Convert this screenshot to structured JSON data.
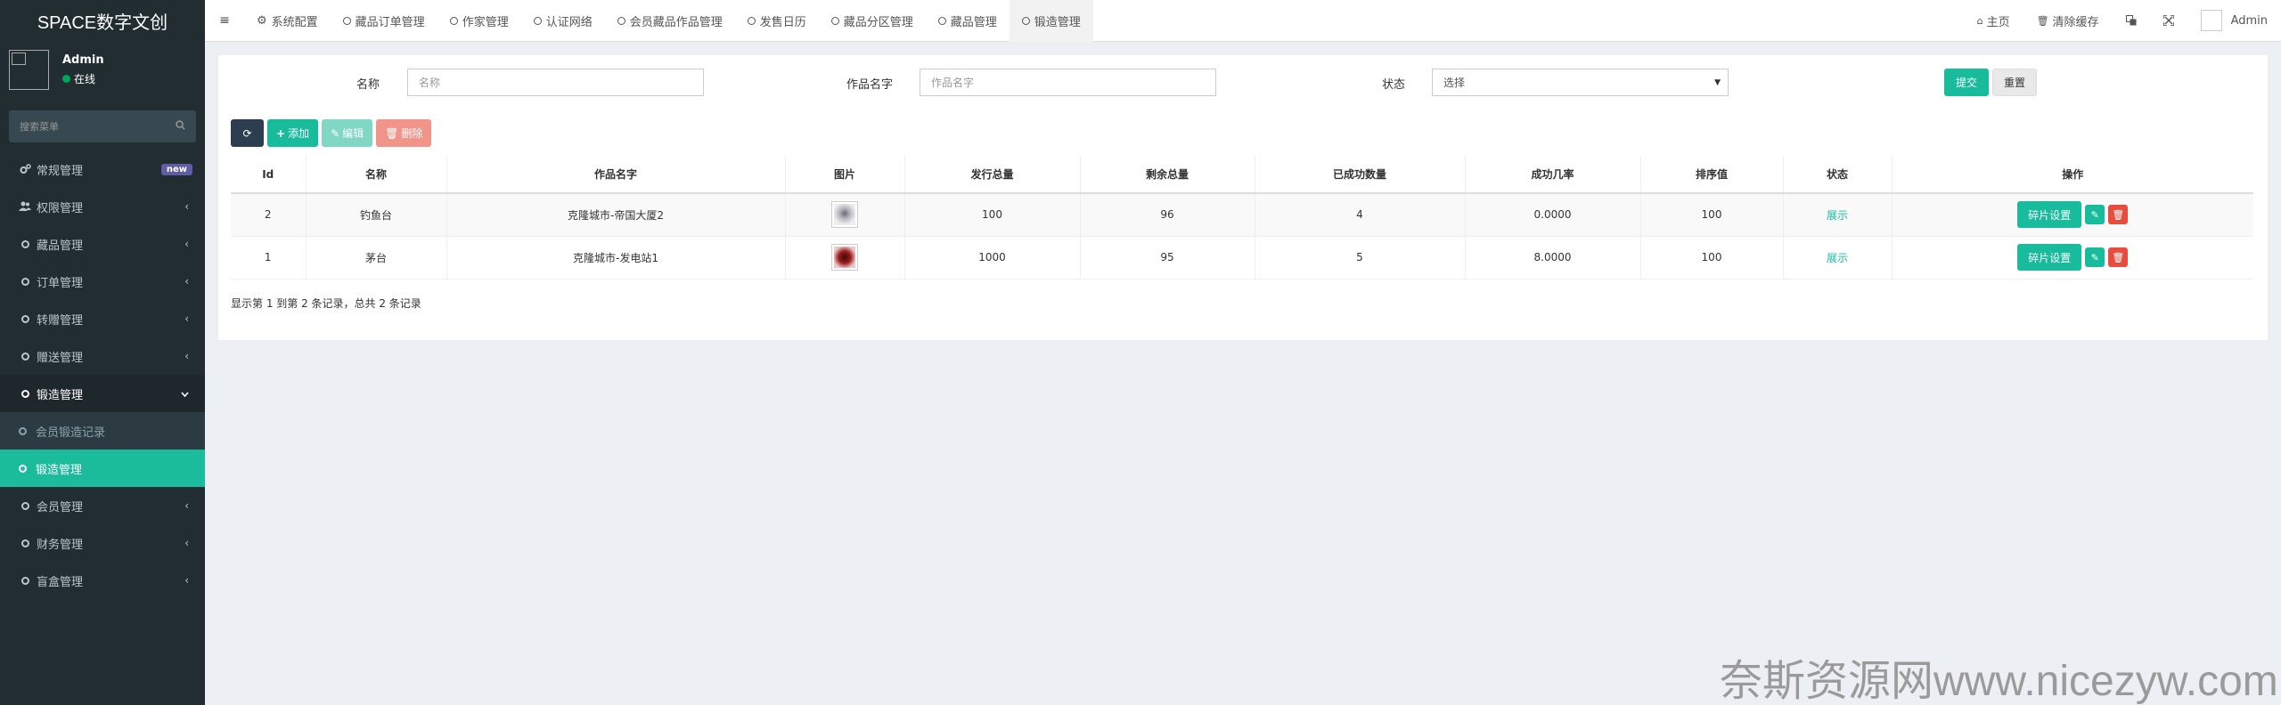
{
  "app": {
    "title": "SPACE数字文创"
  },
  "user": {
    "name": "Admin",
    "status": "在线"
  },
  "sidebar": {
    "search_placeholder": "搜索菜单",
    "items": [
      {
        "label": "常规管理",
        "badge": "new"
      },
      {
        "label": "权限管理"
      },
      {
        "label": "藏品管理"
      },
      {
        "label": "订单管理"
      },
      {
        "label": "转赠管理"
      },
      {
        "label": "赠送管理"
      },
      {
        "label": "锻造管理"
      },
      {
        "label": "会员锻造记录"
      },
      {
        "label": "锻造管理"
      },
      {
        "label": "会员管理"
      },
      {
        "label": "财务管理"
      },
      {
        "label": "盲盒管理"
      }
    ]
  },
  "topbar": {
    "tabs": [
      "系统配置",
      "藏品订单管理",
      "作家管理",
      "认证网络",
      "会员藏品作品管理",
      "发售日历",
      "藏品分区管理",
      "藏品管理",
      "锻造管理"
    ],
    "home": "主页",
    "clear_cache": "清除缓存",
    "user": "Admin"
  },
  "filters": {
    "name_label": "名称",
    "name_placeholder": "名称",
    "work_label": "作品名字",
    "work_placeholder": "作品名字",
    "status_label": "状态",
    "status_value": "选择",
    "submit": "提交",
    "reset": "重置"
  },
  "toolbar": {
    "add": "添加",
    "edit": "编辑",
    "delete": "删除"
  },
  "table": {
    "headers": [
      "Id",
      "名称",
      "作品名字",
      "图片",
      "发行总量",
      "剩余总量",
      "已成功数量",
      "成功几率",
      "排序值",
      "状态",
      "操作"
    ],
    "rows": [
      {
        "id": "2",
        "name": "钓鱼台",
        "work": "克隆城市-帝国大厦2",
        "total": "100",
        "remain": "96",
        "success": "4",
        "rate": "0.0000",
        "sort": "100",
        "status": "展示",
        "frag": "碎片设置"
      },
      {
        "id": "1",
        "name": "茅台",
        "work": "克隆城市-发电站1",
        "total": "1000",
        "remain": "95",
        "success": "5",
        "rate": "8.0000",
        "sort": "100",
        "status": "展示",
        "frag": "碎片设置"
      }
    ]
  },
  "pager": {
    "text": "显示第 1 到第 2 条记录，总共 2 条记录"
  },
  "watermark": "奈斯资源网www.nicezyw.com",
  "colors": {
    "sidebar": "#222d32",
    "accent": "#18bc9c",
    "danger": "#e74c3c"
  }
}
